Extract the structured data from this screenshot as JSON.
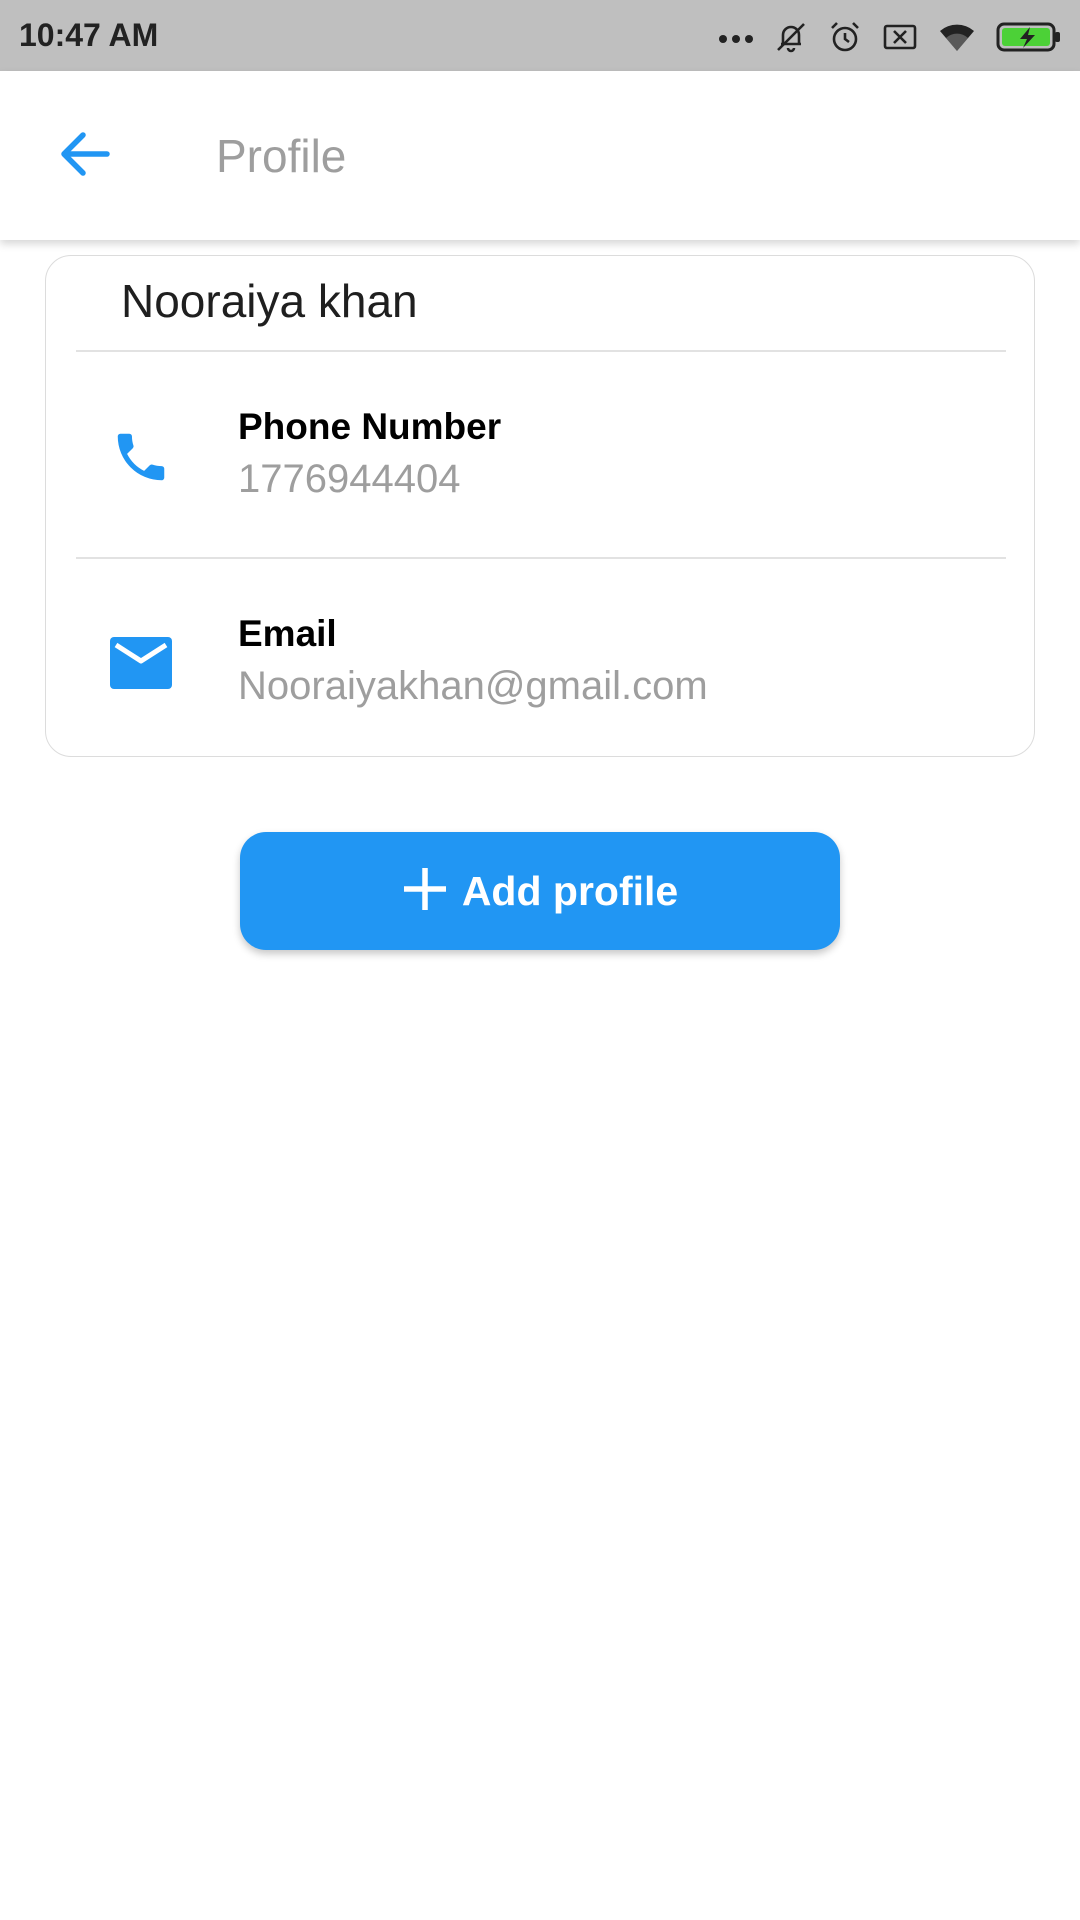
{
  "status_bar": {
    "time": "10:47 AM",
    "icons": [
      "more-dots-icon",
      "muted-bell-icon",
      "alarm-icon",
      "no-sim-icon",
      "wifi-icon",
      "battery-charging-icon"
    ],
    "battery_color": "#4cd137"
  },
  "app_bar": {
    "back_icon": "arrow-back-icon",
    "title": "Profile"
  },
  "profile": {
    "name": "Nooraiya khan",
    "rows": [
      {
        "icon": "phone-icon",
        "label": "Phone Number",
        "value": "1776944404"
      },
      {
        "icon": "email-icon",
        "label": "Email",
        "value": "Nooraiyakhan@gmail.com"
      }
    ]
  },
  "actions": {
    "add_profile_icon": "plus-icon",
    "add_profile_label": "Add profile"
  },
  "colors": {
    "accent": "#2196f3",
    "status_bar_bg": "#bfbfbf",
    "muted_text": "#9e9e9e"
  }
}
